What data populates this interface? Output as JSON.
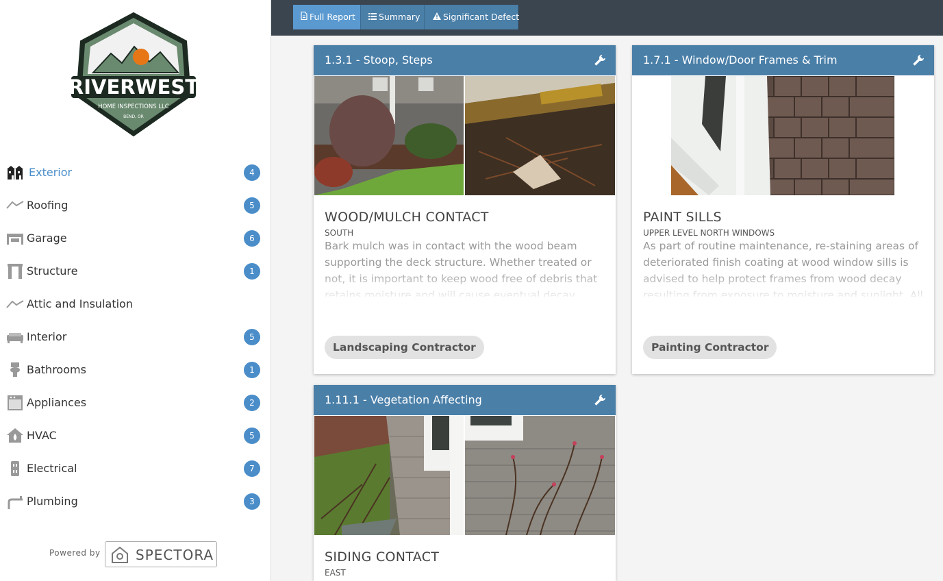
{
  "logo": {
    "brand": "RIVERWEST",
    "tagline": "HOME INSPECTIONS LLC",
    "location": "BEND, OR"
  },
  "nav": {
    "items": [
      {
        "label": "Exterior",
        "count": "4",
        "icon": "house-icon"
      },
      {
        "label": "Roofing",
        "count": "5",
        "icon": "roof-icon"
      },
      {
        "label": "Garage",
        "count": "6",
        "icon": "garage-icon"
      },
      {
        "label": "Structure",
        "count": "1",
        "icon": "structure-icon"
      },
      {
        "label": "Attic and Insulation",
        "count": "",
        "icon": "attic-icon"
      },
      {
        "label": "Interior",
        "count": "5",
        "icon": "sofa-icon"
      },
      {
        "label": "Bathrooms",
        "count": "1",
        "icon": "toilet-icon"
      },
      {
        "label": "Appliances",
        "count": "2",
        "icon": "oven-icon"
      },
      {
        "label": "HVAC",
        "count": "5",
        "icon": "flame-house-icon"
      },
      {
        "label": "Electrical",
        "count": "7",
        "icon": "outlet-icon"
      },
      {
        "label": "Plumbing",
        "count": "3",
        "icon": "pipe-icon"
      }
    ]
  },
  "powered": {
    "text": "Powered by",
    "brand": "SPECTORA"
  },
  "tabs": {
    "full_report": "Full Report",
    "summary": "Summary",
    "significant_defect": "Significant Defect"
  },
  "cards": [
    {
      "header": "1.3.1 - Stoop, Steps",
      "title": "WOOD/MULCH CONTACT",
      "location": "SOUTH",
      "description": "Bark mulch was in contact with the wood beam supporting the deck structure. Whether treated or not, it is important to keep wood free of debris that retains moisture and will cause eventual decay. Recommend",
      "contractor": "Landscaping Contractor"
    },
    {
      "header": "1.7.1 - Window/Door Frames & Trim",
      "title": "PAINT SILLS",
      "location": "UPPER LEVEL NORTH WINDOWS",
      "description": "As part of routine maintenance, re-staining areas of deteriorated finish coating at wood window sills is advised to help protect frames from wood decay resulting from exposure to moisture and sunlight. All",
      "contractor": "Painting Contractor"
    },
    {
      "header": "1.11.1 - Vegetation Affecting",
      "title": "SIDING CONTACT",
      "location": "EAST"
    }
  ],
  "colors": {
    "accent": "#4a8dc9",
    "header": "#4a7fa8",
    "topbar": "#3b4550"
  }
}
